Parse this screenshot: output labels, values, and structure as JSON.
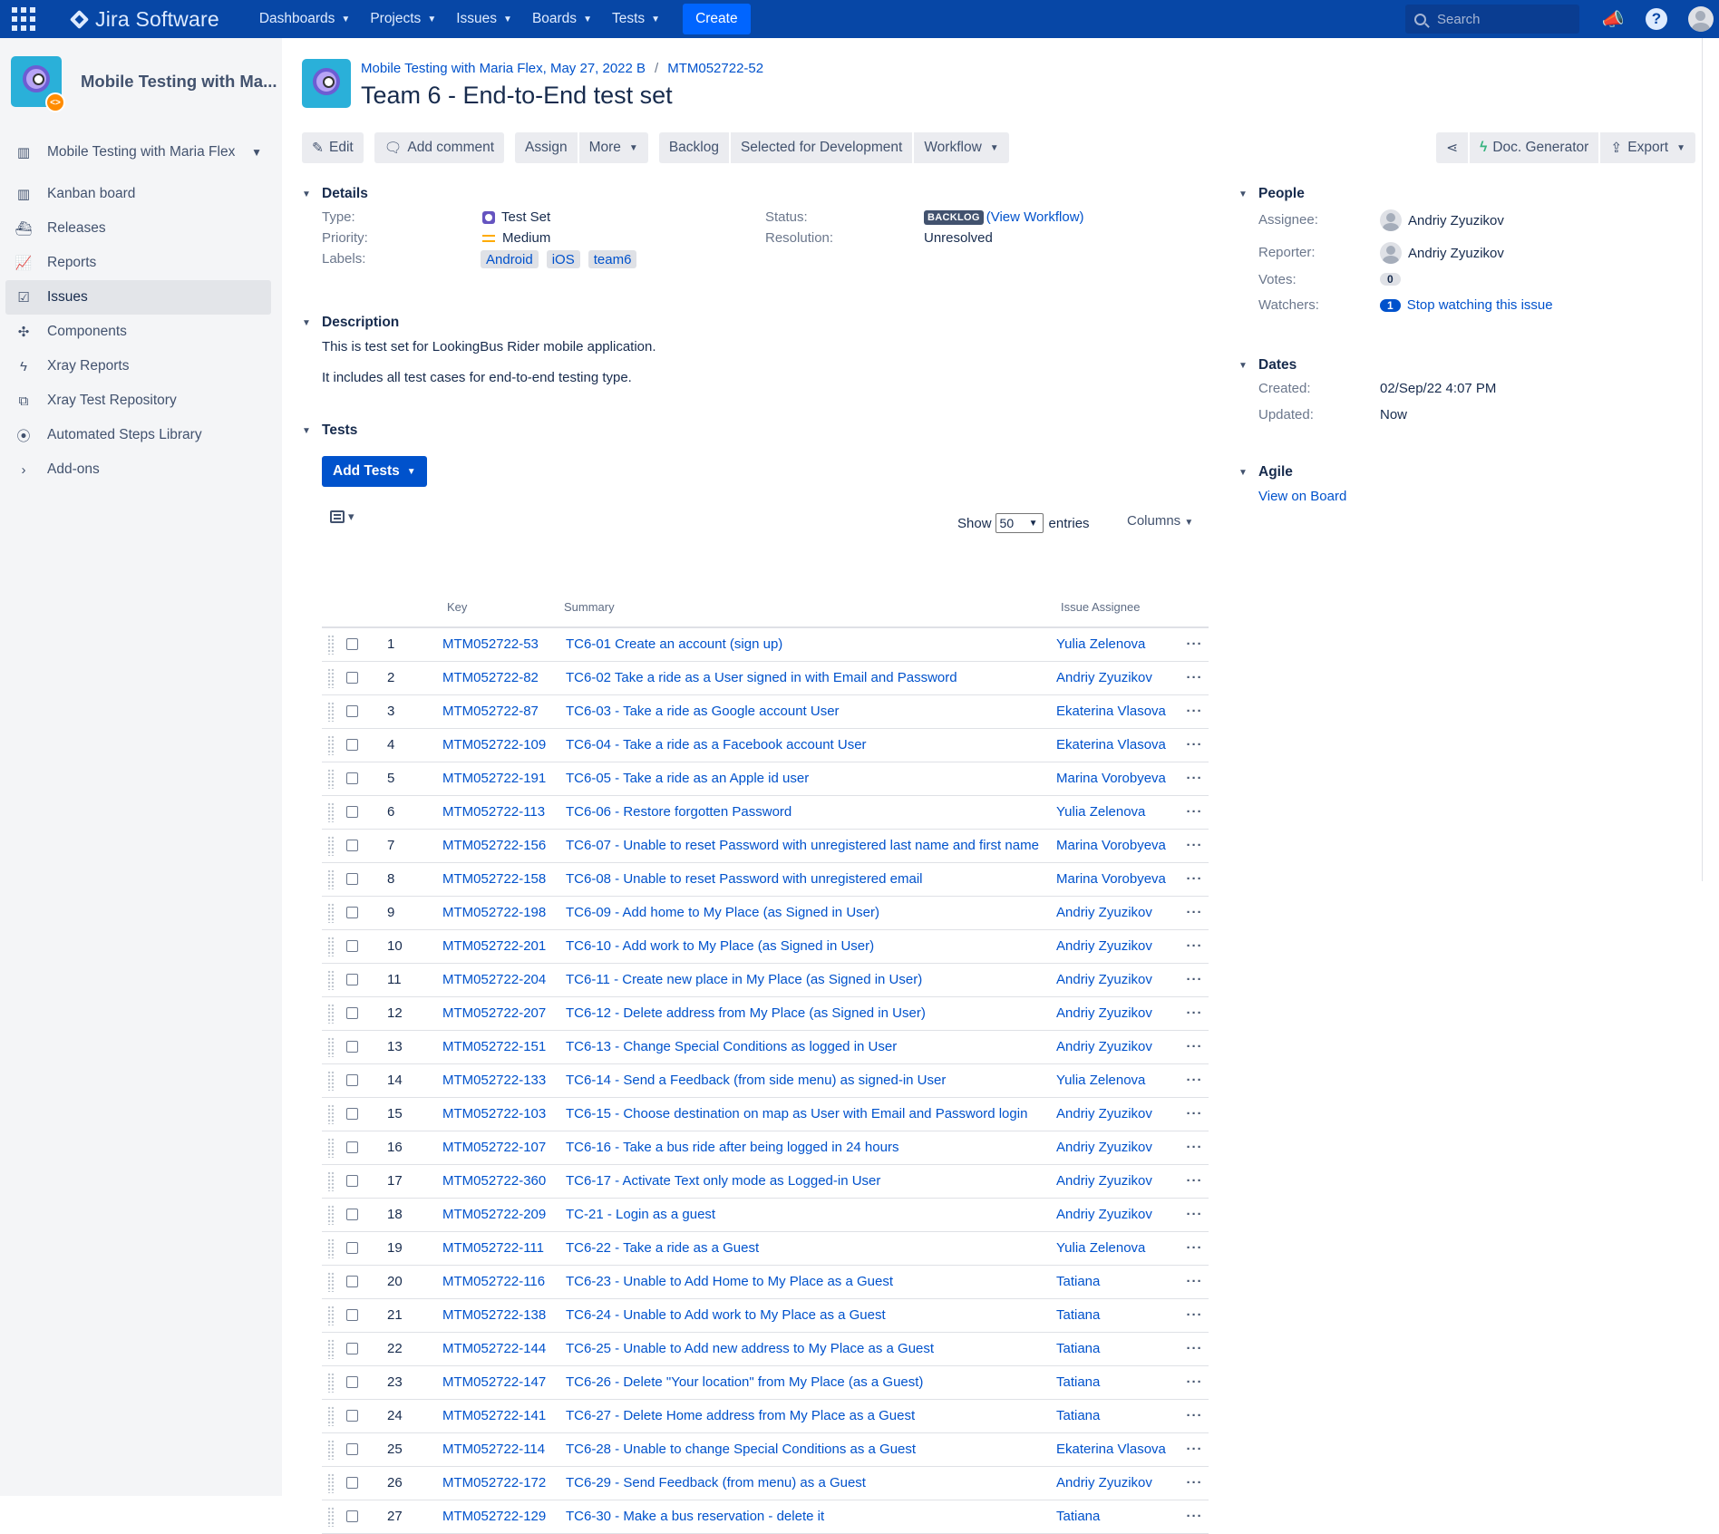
{
  "topnav": {
    "logo_text": "Jira Software",
    "menus": [
      "Dashboards",
      "Projects",
      "Issues",
      "Boards",
      "Tests"
    ],
    "create_label": "Create",
    "search_placeholder": "Search"
  },
  "sidebar": {
    "project_name": "Mobile Testing with Ma...",
    "items": [
      {
        "label": "Mobile Testing with Maria Flex",
        "icon": "board-columns-icon"
      },
      {
        "label": "Kanban board",
        "icon": "kanban-icon"
      },
      {
        "label": "Releases",
        "icon": "ship-icon"
      },
      {
        "label": "Reports",
        "icon": "graph-line-icon"
      },
      {
        "label": "Issues",
        "icon": "issues-icon"
      },
      {
        "label": "Components",
        "icon": "puzzle-icon"
      },
      {
        "label": "Xray Reports",
        "icon": "xray-icon"
      },
      {
        "label": "Xray Test Repository",
        "icon": "repository-icon"
      },
      {
        "label": "Automated Steps Library",
        "icon": "library-icon"
      },
      {
        "label": "Add-ons",
        "icon": "chevron-right-icon"
      }
    ]
  },
  "issue": {
    "breadcrumb_project": "Mobile Testing with Maria Flex, May 27, 2022 B",
    "breadcrumb_key": "MTM052722-52",
    "title": "Team 6 - End-to-End test set"
  },
  "toolbar": {
    "edit": "Edit",
    "add_comment": "Add comment",
    "assign": "Assign",
    "more": "More",
    "backlog": "Backlog",
    "selected": "Selected for Development",
    "workflow": "Workflow",
    "doc_generator": "Doc. Generator",
    "export": "Export"
  },
  "details": {
    "heading": "Details",
    "type_label": "Type:",
    "type_value": "Test Set",
    "priority_label": "Priority:",
    "priority_value": "Medium",
    "labels_label": "Labels:",
    "labels": [
      "Android",
      "iOS",
      "team6"
    ],
    "status_label": "Status:",
    "status_value": "BACKLOG",
    "view_workflow_open": "(",
    "view_workflow": "View Workflow",
    "view_workflow_close": ")",
    "resolution_label": "Resolution:",
    "resolution_value": "Unresolved"
  },
  "description": {
    "heading": "Description",
    "line1": "This is test set for LookingBus Rider mobile application.",
    "line2": "It includes all test cases for end-to-end  testing type."
  },
  "tests": {
    "heading": "Tests",
    "add_tests": "Add Tests",
    "show": "Show",
    "entries_value": "50",
    "entries": "entries",
    "columns": "Columns",
    "headers": {
      "key": "Key",
      "summary": "Summary",
      "assignee": "Issue Assignee"
    },
    "rows": [
      {
        "n": "1",
        "key": "MTM052722-53",
        "summary": "TC6-01 Create an account (sign up)",
        "assignee": "Yulia Zelenova"
      },
      {
        "n": "2",
        "key": "MTM052722-82",
        "summary": "TC6-02 Take a ride as a User signed in with Email and Password",
        "assignee": "Andriy Zyuzikov"
      },
      {
        "n": "3",
        "key": "MTM052722-87",
        "summary": "TC6-03 - Take a ride as Google account User",
        "assignee": "Ekaterina Vlasova"
      },
      {
        "n": "4",
        "key": "MTM052722-109",
        "summary": "TC6-04 - Take a ride as a Facebook account User",
        "assignee": "Ekaterina Vlasova"
      },
      {
        "n": "5",
        "key": "MTM052722-191",
        "summary": "TC6-05 - Take a ride as an Apple id user",
        "assignee": "Marina Vorobyeva"
      },
      {
        "n": "6",
        "key": "MTM052722-113",
        "summary": "TC6-06 - Restore forgotten Password",
        "assignee": "Yulia Zelenova"
      },
      {
        "n": "7",
        "key": "MTM052722-156",
        "summary": "TC6-07 - Unable to reset Password with unregistered last name and first name",
        "assignee": "Marina Vorobyeva"
      },
      {
        "n": "8",
        "key": "MTM052722-158",
        "summary": "TC6-08 - Unable to reset Password with unregistered email",
        "assignee": "Marina Vorobyeva"
      },
      {
        "n": "9",
        "key": "MTM052722-198",
        "summary": "TC6-09 - Add home to My Place (as Signed in User)",
        "assignee": "Andriy Zyuzikov"
      },
      {
        "n": "10",
        "key": "MTM052722-201",
        "summary": "TC6-10 - Add work to My Place (as Signed in User)",
        "assignee": "Andriy Zyuzikov"
      },
      {
        "n": "11",
        "key": "MTM052722-204",
        "summary": "TC6-11 - Create new place in My Place (as Signed in User)",
        "assignee": "Andriy Zyuzikov"
      },
      {
        "n": "12",
        "key": "MTM052722-207",
        "summary": "TC6-12 - Delete address from My Place (as Signed in User)",
        "assignee": "Andriy Zyuzikov"
      },
      {
        "n": "13",
        "key": "MTM052722-151",
        "summary": "TC6-13 - Change Special Conditions as logged in User",
        "assignee": "Andriy Zyuzikov"
      },
      {
        "n": "14",
        "key": "MTM052722-133",
        "summary": "TC6-14 - Send a Feedback (from side menu) as signed-in User",
        "assignee": "Yulia Zelenova"
      },
      {
        "n": "15",
        "key": "MTM052722-103",
        "summary": "TC6-15 - Choose destination on map as User with Email and Password login",
        "assignee": "Andriy Zyuzikov"
      },
      {
        "n": "16",
        "key": "MTM052722-107",
        "summary": "TC6-16 - Take a bus ride after being logged in 24 hours",
        "assignee": "Andriy Zyuzikov"
      },
      {
        "n": "17",
        "key": "MTM052722-360",
        "summary": "TC6-17 - Activate Text only mode as Logged-in User",
        "assignee": "Andriy Zyuzikov"
      },
      {
        "n": "18",
        "key": "MTM052722-209",
        "summary": "TC-21 - Login as a guest",
        "assignee": "Andriy Zyuzikov"
      },
      {
        "n": "19",
        "key": "MTM052722-111",
        "summary": "TC6-22 - Take a ride as a Guest",
        "assignee": "Yulia Zelenova"
      },
      {
        "n": "20",
        "key": "MTM052722-116",
        "summary": "TC6-23 - Unable to Add Home to My Place as a Guest",
        "assignee": "Tatiana"
      },
      {
        "n": "21",
        "key": "MTM052722-138",
        "summary": "TC6-24 - Unable to Add work to My Place as a Guest",
        "assignee": "Tatiana"
      },
      {
        "n": "22",
        "key": "MTM052722-144",
        "summary": "TC6-25 - Unable to Add new address to My Place as a Guest",
        "assignee": "Tatiana"
      },
      {
        "n": "23",
        "key": "MTM052722-147",
        "summary": "TC6-26 - Delete \"Your location\" from My Place (as a Guest)",
        "assignee": "Tatiana"
      },
      {
        "n": "24",
        "key": "MTM052722-141",
        "summary": "TC6-27 - Delete Home address from My Place as a Guest",
        "assignee": "Tatiana"
      },
      {
        "n": "25",
        "key": "MTM052722-114",
        "summary": "TC6-28 - Unable to change Special Conditions as a Guest",
        "assignee": "Ekaterina Vlasova"
      },
      {
        "n": "26",
        "key": "MTM052722-172",
        "summary": "TC6-29 - Send Feedback (from menu) as a Guest",
        "assignee": "Andriy Zyuzikov"
      },
      {
        "n": "27",
        "key": "MTM052722-129",
        "summary": "TC6-30 - Make a bus reservation - delete it",
        "assignee": "Tatiana"
      }
    ]
  },
  "people": {
    "heading": "People",
    "assignee_label": "Assignee:",
    "assignee": "Andriy Zyuzikov",
    "reporter_label": "Reporter:",
    "reporter": "Andriy Zyuzikov",
    "votes_label": "Votes:",
    "votes": "0",
    "watchers_label": "Watchers:",
    "watchers": "1",
    "stop_watching": "Stop watching this issue"
  },
  "dates": {
    "heading": "Dates",
    "created_label": "Created:",
    "created": "02/Sep/22 4:07 PM",
    "updated_label": "Updated:",
    "updated": "Now"
  },
  "agile": {
    "heading": "Agile",
    "link": "View on Board"
  }
}
